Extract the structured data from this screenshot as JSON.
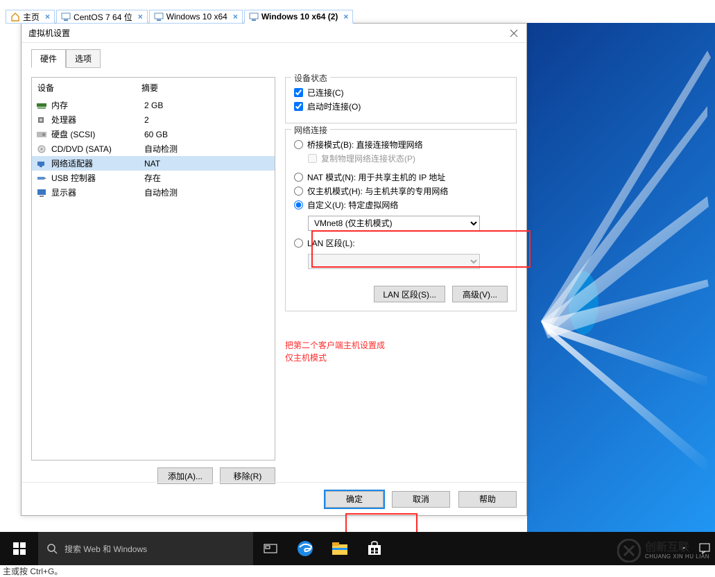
{
  "vmware_tabs": [
    {
      "label": "主页",
      "icon": "home-icon"
    },
    {
      "label": "CentOS 7 64 位",
      "icon": "vm-icon"
    },
    {
      "label": "Windows 10 x64",
      "icon": "vm-icon"
    },
    {
      "label": "Windows 10 x64 (2)",
      "icon": "vm-icon",
      "active": true
    }
  ],
  "dialog": {
    "title": "虚拟机设置",
    "tabs": {
      "hardware": "硬件",
      "options": "选项"
    },
    "device_header": {
      "name": "设备",
      "summary": "摘要"
    },
    "devices": [
      {
        "icon": "memory-icon",
        "name": "内存",
        "summary": "2 GB"
      },
      {
        "icon": "cpu-icon",
        "name": "处理器",
        "summary": "2"
      },
      {
        "icon": "disk-icon",
        "name": "硬盘 (SCSI)",
        "summary": "60 GB"
      },
      {
        "icon": "cd-icon",
        "name": "CD/DVD (SATA)",
        "summary": "自动检测"
      },
      {
        "icon": "network-icon",
        "name": "网络适配器",
        "summary": "NAT",
        "selected": true
      },
      {
        "icon": "usb-icon",
        "name": "USB 控制器",
        "summary": "存在"
      },
      {
        "icon": "display-icon",
        "name": "显示器",
        "summary": "自动检测"
      }
    ],
    "add_btn": "添加(A)...",
    "remove_btn": "移除(R)",
    "device_status": {
      "title": "设备状态",
      "connected": "已连接(C)",
      "connect_at_poweron": "启动时连接(O)"
    },
    "network": {
      "title": "网络连接",
      "bridged": "桥接模式(B): 直接连接物理网络",
      "replicate": "复制物理网络连接状态(P)",
      "nat": "NAT 模式(N): 用于共享主机的 IP 地址",
      "hostonly": "仅主机模式(H): 与主机共享的专用网络",
      "custom": "自定义(U): 特定虚拟网络",
      "custom_value": "VMnet8 (仅主机模式)",
      "lan": "LAN 区段(L):",
      "lan_btn": "LAN 区段(S)...",
      "adv_btn": "高级(V)..."
    },
    "ok": "确定",
    "cancel": "取消",
    "help": "帮助"
  },
  "annotation": {
    "line1": "把第二个客户端主机设置成",
    "line2": "仅主机模式"
  },
  "taskbar": {
    "search_placeholder": "搜索 Web 和 Windows"
  },
  "hint": "主或按 Ctrl+G。",
  "logo": {
    "name": "创新互联",
    "sub": "CHUANG XIN HU LIAN"
  }
}
